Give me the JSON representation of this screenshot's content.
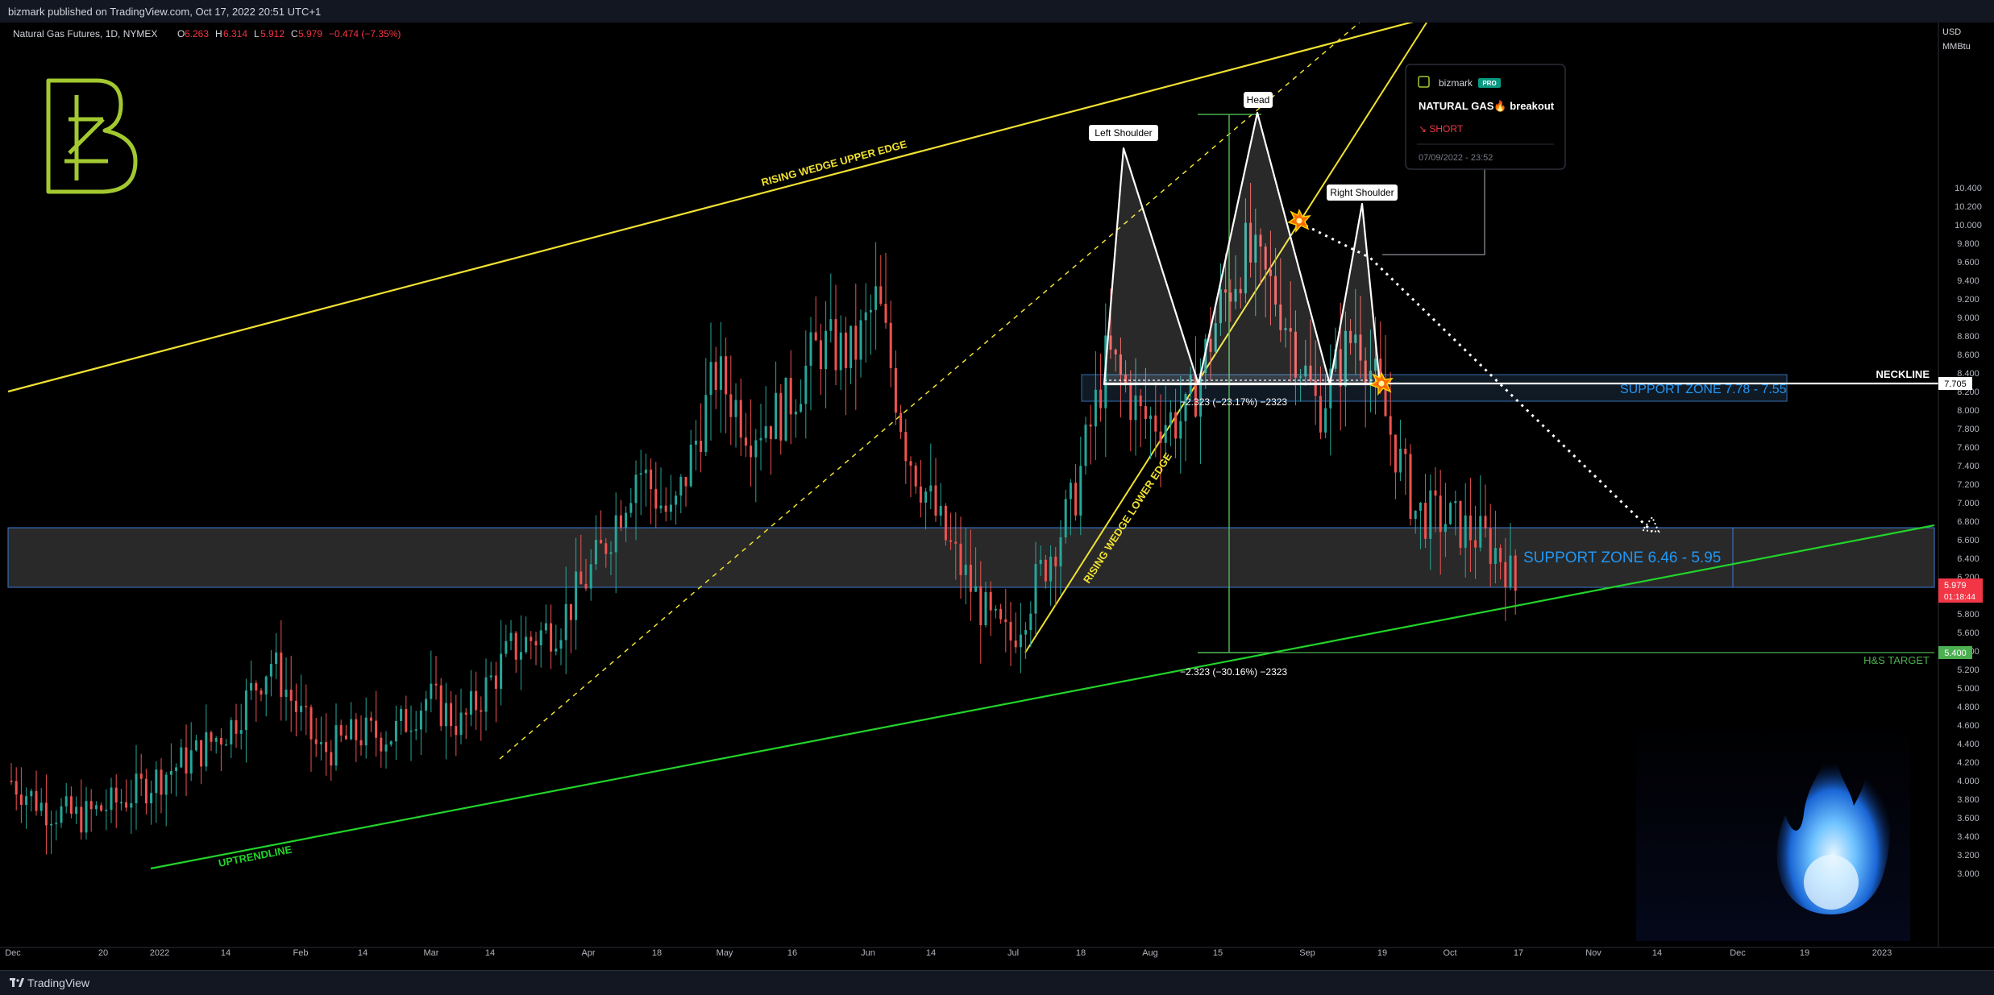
{
  "header": {
    "published": "bizmark published on TradingView.com, Oct 17, 2022 20:51 UTC+1",
    "symbol_desc": "Natural Gas Futures, 1D, NYMEX",
    "ohlc": {
      "o_label": "O",
      "o": "6.263",
      "h_label": "H",
      "h": "6.314",
      "l_label": "L",
      "l": "5.912",
      "c_label": "C",
      "c": "5.979",
      "change": "−0.474 (−7.35%)"
    }
  },
  "footer": {
    "brand": "TradingView"
  },
  "axis": {
    "currency": "USD",
    "unit": "MMBtu",
    "y_ticks": [
      "10.400",
      "10.000",
      "9.600",
      "9.200",
      "8.800",
      "8.400",
      "8.000",
      "7.600",
      "7.200",
      "6.800",
      "6.400",
      "6.000",
      "5.600",
      "5.200",
      "4.800",
      "4.400",
      "4.000",
      "3.600",
      "3.200"
    ],
    "y_ticks_minor": [
      "10.200",
      "9.800",
      "9.400",
      "9.000",
      "8.600",
      "8.200",
      "7.800",
      "7.400",
      "7.000",
      "6.600",
      "6.200",
      "5.800",
      "5.400",
      "5.000",
      "4.600",
      "4.200",
      "3.800",
      "3.400",
      "3.000"
    ],
    "x_ticks": [
      "Dec",
      "20",
      "2022",
      "14",
      "Feb",
      "14",
      "Mar",
      "14",
      "Apr",
      "18",
      "May",
      "16",
      "Jun",
      "14",
      "Jul",
      "18",
      "Aug",
      "15",
      "Sep",
      "19",
      "Oct",
      "17",
      "Nov",
      "14",
      "Dec",
      "19",
      "2023"
    ],
    "price_tag": {
      "value": "5.979",
      "countdown": "01:18:44",
      "color": "#f23645"
    },
    "neckline_tag": {
      "value": "7.705",
      "color": "#ffffff"
    },
    "target_tag": {
      "value": "5.400",
      "color": "#4caf50"
    }
  },
  "chart_data": {
    "type": "candlestick",
    "title": "Natural Gas Futures, 1D, NYMEX",
    "ylabel": "USD MMBtu",
    "ylim": [
      3.0,
      10.6
    ],
    "grid": false,
    "last": {
      "open": 6.263,
      "high": 6.314,
      "low": 5.912,
      "close": 5.979,
      "change": -0.474,
      "change_pct": -7.35
    },
    "anchors": [
      {
        "date": "2021-12-13",
        "value": 4.0
      },
      {
        "date": "2021-12-20",
        "value": 3.7
      },
      {
        "date": "2021-12-27",
        "value": 3.6
      },
      {
        "date": "2022-01-05",
        "value": 3.8
      },
      {
        "date": "2022-01-20",
        "value": 4.3
      },
      {
        "date": "2022-01-27",
        "value": 4.6
      },
      {
        "date": "2022-02-04",
        "value": 5.3
      },
      {
        "date": "2022-02-14",
        "value": 4.3
      },
      {
        "date": "2022-02-22",
        "value": 4.5
      },
      {
        "date": "2022-03-01",
        "value": 4.5
      },
      {
        "date": "2022-03-08",
        "value": 4.9
      },
      {
        "date": "2022-03-15",
        "value": 4.6
      },
      {
        "date": "2022-03-25",
        "value": 5.4
      },
      {
        "date": "2022-04-04",
        "value": 5.7
      },
      {
        "date": "2022-04-12",
        "value": 6.4
      },
      {
        "date": "2022-04-20",
        "value": 7.4
      },
      {
        "date": "2022-04-27",
        "value": 6.8
      },
      {
        "date": "2022-05-06",
        "value": 8.4
      },
      {
        "date": "2022-05-13",
        "value": 7.8
      },
      {
        "date": "2022-05-20",
        "value": 8.0
      },
      {
        "date": "2022-05-27",
        "value": 8.7
      },
      {
        "date": "2022-06-03",
        "value": 8.6
      },
      {
        "date": "2022-06-08",
        "value": 9.2
      },
      {
        "date": "2022-06-14",
        "value": 7.6
      },
      {
        "date": "2022-06-22",
        "value": 6.6
      },
      {
        "date": "2022-07-01",
        "value": 5.7
      },
      {
        "date": "2022-07-05",
        "value": 5.5
      },
      {
        "date": "2022-07-11",
        "value": 6.2
      },
      {
        "date": "2022-07-18",
        "value": 7.0
      },
      {
        "date": "2022-07-25",
        "value": 8.6
      },
      {
        "date": "2022-08-01",
        "value": 7.9
      },
      {
        "date": "2022-08-10",
        "value": 7.9
      },
      {
        "date": "2022-08-17",
        "value": 9.1
      },
      {
        "date": "2022-08-22",
        "value": 9.7
      },
      {
        "date": "2022-08-29",
        "value": 9.2
      },
      {
        "date": "2022-09-06",
        "value": 8.0
      },
      {
        "date": "2022-09-14",
        "value": 8.9
      },
      {
        "date": "2022-09-20",
        "value": 7.9
      },
      {
        "date": "2022-09-26",
        "value": 6.9
      },
      {
        "date": "2022-10-03",
        "value": 6.8
      },
      {
        "date": "2022-10-10",
        "value": 6.6
      },
      {
        "date": "2022-10-14",
        "value": 6.4
      },
      {
        "date": "2022-10-17",
        "value": 5.98
      }
    ]
  },
  "annotations": {
    "upper_edge_label": "RISING WEDGE UPPER EDGE",
    "lower_edge_label": "RISING WEDGE LOWER EDGE",
    "uptrend_label": "UPTRENDLINE",
    "left_shoulder": "Left Shoulder",
    "head": "Head",
    "right_shoulder": "Right Shoulder",
    "neckline": "NECKLINE",
    "support_upper": "SUPPORT ZONE 7.78 - 7.55",
    "support_lower": "SUPPORT ZONE 6.46 - 5.95",
    "target": "H&S TARGET",
    "measure1": "−2.323 (−23.17%) −2323",
    "measure2": "−2.323 (−30.16%) −2323"
  },
  "idea": {
    "author": "bizmark",
    "badge": "PRO",
    "title": "NATURAL GAS🔥 breakout",
    "direction": "↘ SHORT",
    "date": "07/09/2022 - 23:52"
  },
  "colors": {
    "background": "#000000",
    "bull": "#26a69a",
    "bear": "#ef5350",
    "wedge": "#f0e130",
    "uptrend": "#22d32a",
    "support_blue": "#2196f3",
    "target_green": "#4caf50",
    "logo": "#a3c930"
  },
  "icons": {
    "logo": "bizmark-logo-icon",
    "flame": "blue-flame-icon",
    "burst": "burst-icon"
  }
}
